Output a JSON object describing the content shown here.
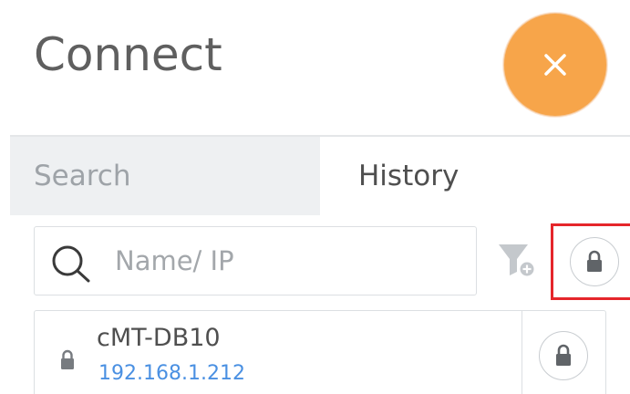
{
  "header": {
    "title": "Connect",
    "close_icon": "close-icon",
    "close_color": "#f7a54a"
  },
  "tabs": [
    {
      "label": "Search",
      "active": false
    },
    {
      "label": "History",
      "active": true
    }
  ],
  "search": {
    "placeholder": "Name/ IP",
    "value": ""
  },
  "toolbar": {
    "filter_icon": "filter-add-icon",
    "lock_icon": "lock-icon",
    "highlight_color": "#e5262b"
  },
  "history": [
    {
      "name": "cMT-DB10",
      "ip": "192.168.1.212",
      "locked": true
    }
  ],
  "colors": {
    "ip_link": "#4a90e2",
    "accent": "#f7a54a"
  }
}
